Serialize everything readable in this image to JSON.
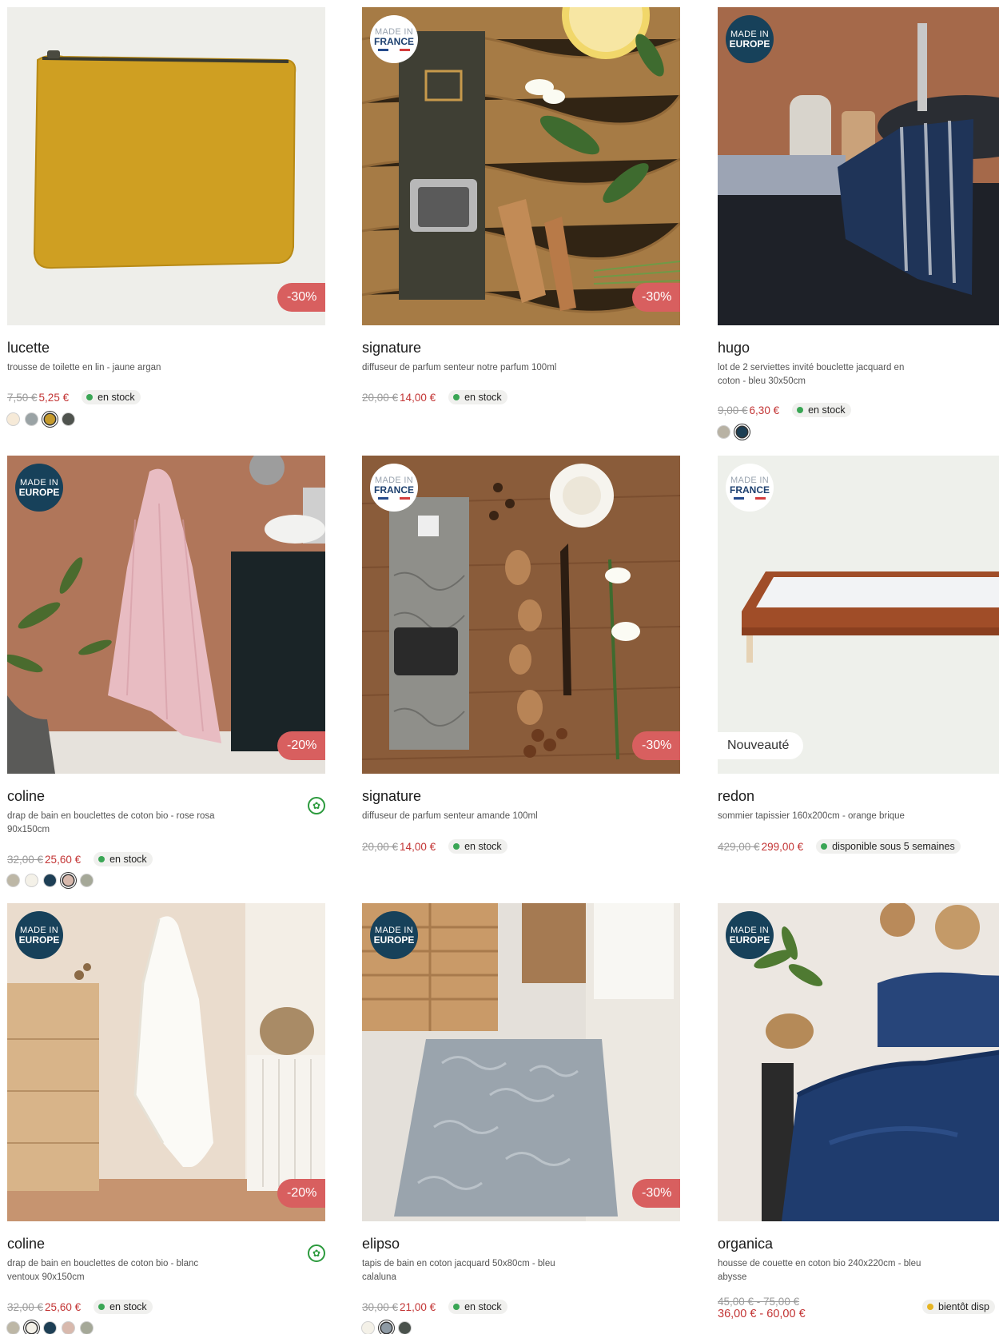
{
  "badges": {
    "europe": [
      "MADE IN",
      "EUROPE"
    ],
    "france": [
      "MADE IN",
      "FRANCE"
    ]
  },
  "products": [
    {
      "id": "p1",
      "name": "lucette",
      "desc": "trousse de toilette en lin - jaune argan",
      "old_price": "7,50 €",
      "new_price": "5,25 €",
      "stock": "en stock",
      "discount": "-30%",
      "swatches": [
        "#f6ead8",
        "#9aa3a5",
        "#c59a2d",
        "#4f534e"
      ],
      "selected": 2
    },
    {
      "id": "p2",
      "name": "signature",
      "desc": "diffuseur de parfum senteur notre parfum 100ml",
      "old_price": "20,00 €",
      "new_price": "14,00 €",
      "stock": "en stock",
      "discount": "-30%"
    },
    {
      "id": "p3",
      "name": "hugo",
      "desc": "lot de 2 serviettes invité bouclette jacquard en coton - bleu 30x50cm",
      "old_price": "9,00 €",
      "new_price": "6,30 €",
      "stock": "en stock",
      "swatches": [
        "#b8b2a4",
        "#1d3f54"
      ],
      "selected": 1
    },
    {
      "id": "p4",
      "name": "coline",
      "desc": "drap de bain en bouclettes de coton bio - rose rosa 90x150cm",
      "old_price": "32,00 €",
      "new_price": "25,60 €",
      "stock": "en stock",
      "discount": "-20%",
      "swatches": [
        "#bdb7a6",
        "#f4f1e8",
        "#1e3f55",
        "#d8b9ad",
        "#a5a898"
      ],
      "selected": 3
    },
    {
      "id": "p5",
      "name": "signature",
      "desc": "diffuseur de parfum senteur amande 100ml",
      "old_price": "20,00 €",
      "new_price": "14,00 €",
      "stock": "en stock",
      "discount": "-30%"
    },
    {
      "id": "p6",
      "name": "redon",
      "desc": "sommier tapissier 160x200cm - orange brique",
      "old_price": "429,00 €",
      "new_price": "299,00 €",
      "stock": "disponible sous 5 semaines",
      "tag": "Nouveauté"
    },
    {
      "id": "p7",
      "name": "coline",
      "desc": "drap de bain en bouclettes de coton bio - blanc ventoux 90x150cm",
      "old_price": "32,00 €",
      "new_price": "25,60 €",
      "stock": "en stock",
      "discount": "-20%",
      "swatches": [
        "#bdb7a6",
        "#f4f1e8",
        "#1e3f55",
        "#d8b9ad",
        "#a5a898"
      ],
      "selected": 1
    },
    {
      "id": "p8",
      "name": "elipso",
      "desc": "tapis de bain en coton jacquard 50x80cm - bleu calaluna",
      "old_price": "30,00 €",
      "new_price": "21,00 €",
      "stock": "en stock",
      "discount": "-30%",
      "swatches": [
        "#f4f1e8",
        "#8e9aa4",
        "#4a524c"
      ],
      "selected": 1
    },
    {
      "id": "p9",
      "name": "organica",
      "desc": "housse de couette en coton bio 240x220cm - bleu abysse",
      "old_price": "45,00 € - 75,00 €",
      "new_price": "36,00 € - 60,00 €",
      "stock": "bientôt disp"
    }
  ]
}
